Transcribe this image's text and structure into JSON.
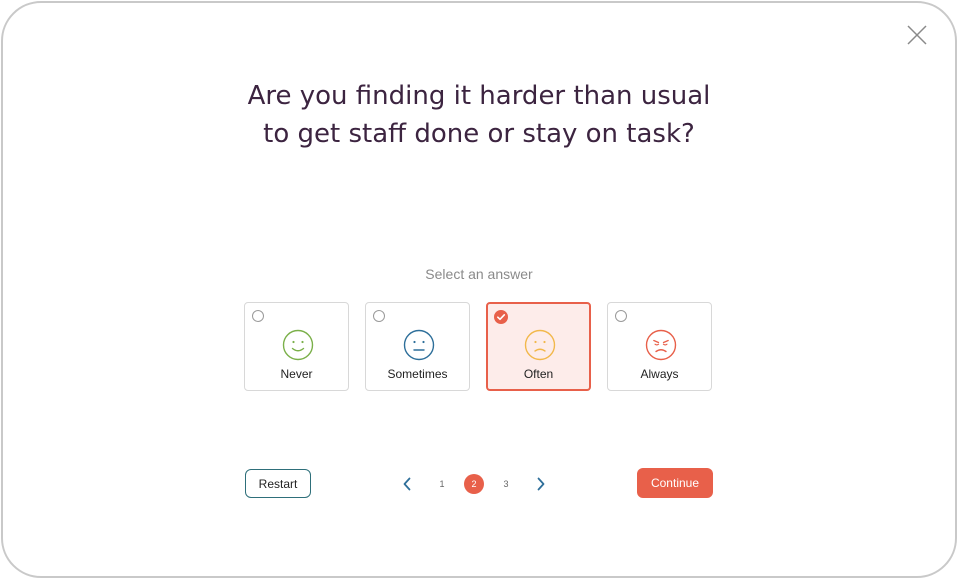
{
  "question": {
    "line1": "Are you finding it harder than usual",
    "line2": "to get staff done or stay on task?"
  },
  "prompt": "Select an answer",
  "options": [
    {
      "label": "Never",
      "face": "smile-face-icon",
      "color": "#7bb04a",
      "selected": false
    },
    {
      "label": "Sometimes",
      "face": "neutral-face-icon",
      "color": "#2e6f9a",
      "selected": false
    },
    {
      "label": "Often",
      "face": "frown-face-icon",
      "color": "#f2b84b",
      "selected": true
    },
    {
      "label": "Always",
      "face": "sad-face-icon",
      "color": "#e8604a",
      "selected": false
    }
  ],
  "pagination": {
    "pages": [
      "1",
      "2",
      "3"
    ],
    "current": "2"
  },
  "buttons": {
    "restart": "Restart",
    "continue": "Continue"
  },
  "colors": {
    "accent": "#e8604a",
    "title": "#3c2440",
    "outline": "#2e6f7a"
  }
}
